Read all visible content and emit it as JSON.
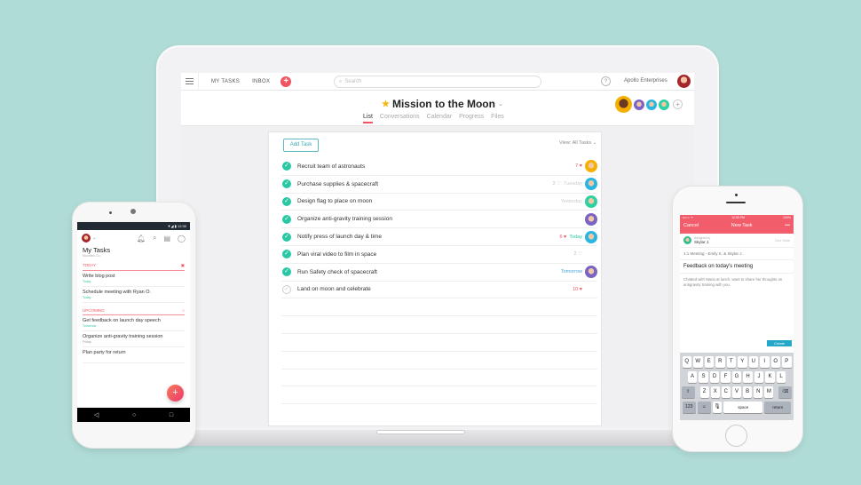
{
  "tablet": {
    "topbar": {
      "nav": [
        "MY TASKS",
        "INBOX"
      ],
      "search_placeholder": "Search",
      "help": "?",
      "org": "Apollo Enterprises"
    },
    "project": {
      "title": "Mission to the Moon",
      "tabs": [
        "List",
        "Conversations",
        "Calendar",
        "Progress",
        "Files"
      ],
      "active_tab": "List"
    },
    "panel": {
      "add_task": "Add Task",
      "view_filter": "View: All Tasks ⌄",
      "tasks": [
        {
          "name": "Recruit team of astronauts",
          "done": true,
          "likes": "7",
          "liked": true,
          "due": "",
          "assignee_color": "#f5b000"
        },
        {
          "name": "Purchase supplies & spacecraft",
          "done": true,
          "likes": "2",
          "liked": false,
          "due": "Tuesday",
          "assignee_color": "#29b6e0"
        },
        {
          "name": "Design flag to place on moon",
          "done": true,
          "likes": "",
          "liked": false,
          "due": "Yesterday",
          "assignee_color": "#2dd0a0"
        },
        {
          "name": "Organize anti-gravity training session",
          "done": true,
          "likes": "",
          "liked": false,
          "due": "",
          "assignee_color": "#7a64c4"
        },
        {
          "name": "Notify press of launch day & time",
          "done": true,
          "likes": "6",
          "liked": true,
          "due": "Today",
          "assignee_color": "#29b6e0"
        },
        {
          "name": "Plan viral video to film in space",
          "done": true,
          "likes": "2",
          "liked": false,
          "due": "",
          "assignee_color": ""
        },
        {
          "name": "Run Safety check of spacecraft",
          "done": true,
          "likes": "",
          "liked": false,
          "due": "Tomorrow",
          "assignee_color": "#7a64c4"
        },
        {
          "name": "Land on moon and celebrate",
          "done": false,
          "likes": "10",
          "liked": true,
          "due": "",
          "assignee_color": ""
        }
      ]
    },
    "members": [
      "#f5b000",
      "#7a64c4",
      "#29b6e0",
      "#2dd0a0"
    ]
  },
  "android": {
    "time": "12:30",
    "title": "My Tasks",
    "subtitle": "Moonlink Co.",
    "sections": [
      {
        "label": "TODAY",
        "items": [
          {
            "name": "Write blog post",
            "due": "Today"
          },
          {
            "name": "Schedule meeting with Ryan O.",
            "due": "Today"
          }
        ]
      },
      {
        "label": "UPCOMING",
        "items": [
          {
            "name": "Get feedback on launch day speech",
            "due": "Tomorrow"
          },
          {
            "name": "Organize anti-gravity training session",
            "due": "Friday"
          },
          {
            "name": "Plan party for return",
            "due": ""
          }
        ]
      }
    ],
    "fab": "+"
  },
  "iphone": {
    "status": {
      "carrier": "•••○○ ᯤ",
      "time": "12:30 PM",
      "battery": "100%"
    },
    "header": {
      "cancel": "Cancel",
      "title": "New Task",
      "more": "•••"
    },
    "assigned_label": "Assigned to",
    "assignee": "Skylar J.",
    "due_label": "Due Date",
    "project": "1:1 Meeting - Emily K. & Skylar J.",
    "task_name": "Feedback on today's meeting",
    "description": "Chatted with Maria at lunch, want to share her thoughts on antigravity training with you.",
    "create": "Create",
    "keyboard": {
      "row1": [
        "Q",
        "W",
        "E",
        "R",
        "T",
        "Y",
        "U",
        "I",
        "O",
        "P"
      ],
      "row2": [
        "A",
        "S",
        "D",
        "F",
        "G",
        "H",
        "J",
        "K",
        "L"
      ],
      "row3": [
        "Z",
        "X",
        "C",
        "V",
        "B",
        "N",
        "M"
      ],
      "num": "123",
      "space": "space",
      "return": "return"
    }
  }
}
